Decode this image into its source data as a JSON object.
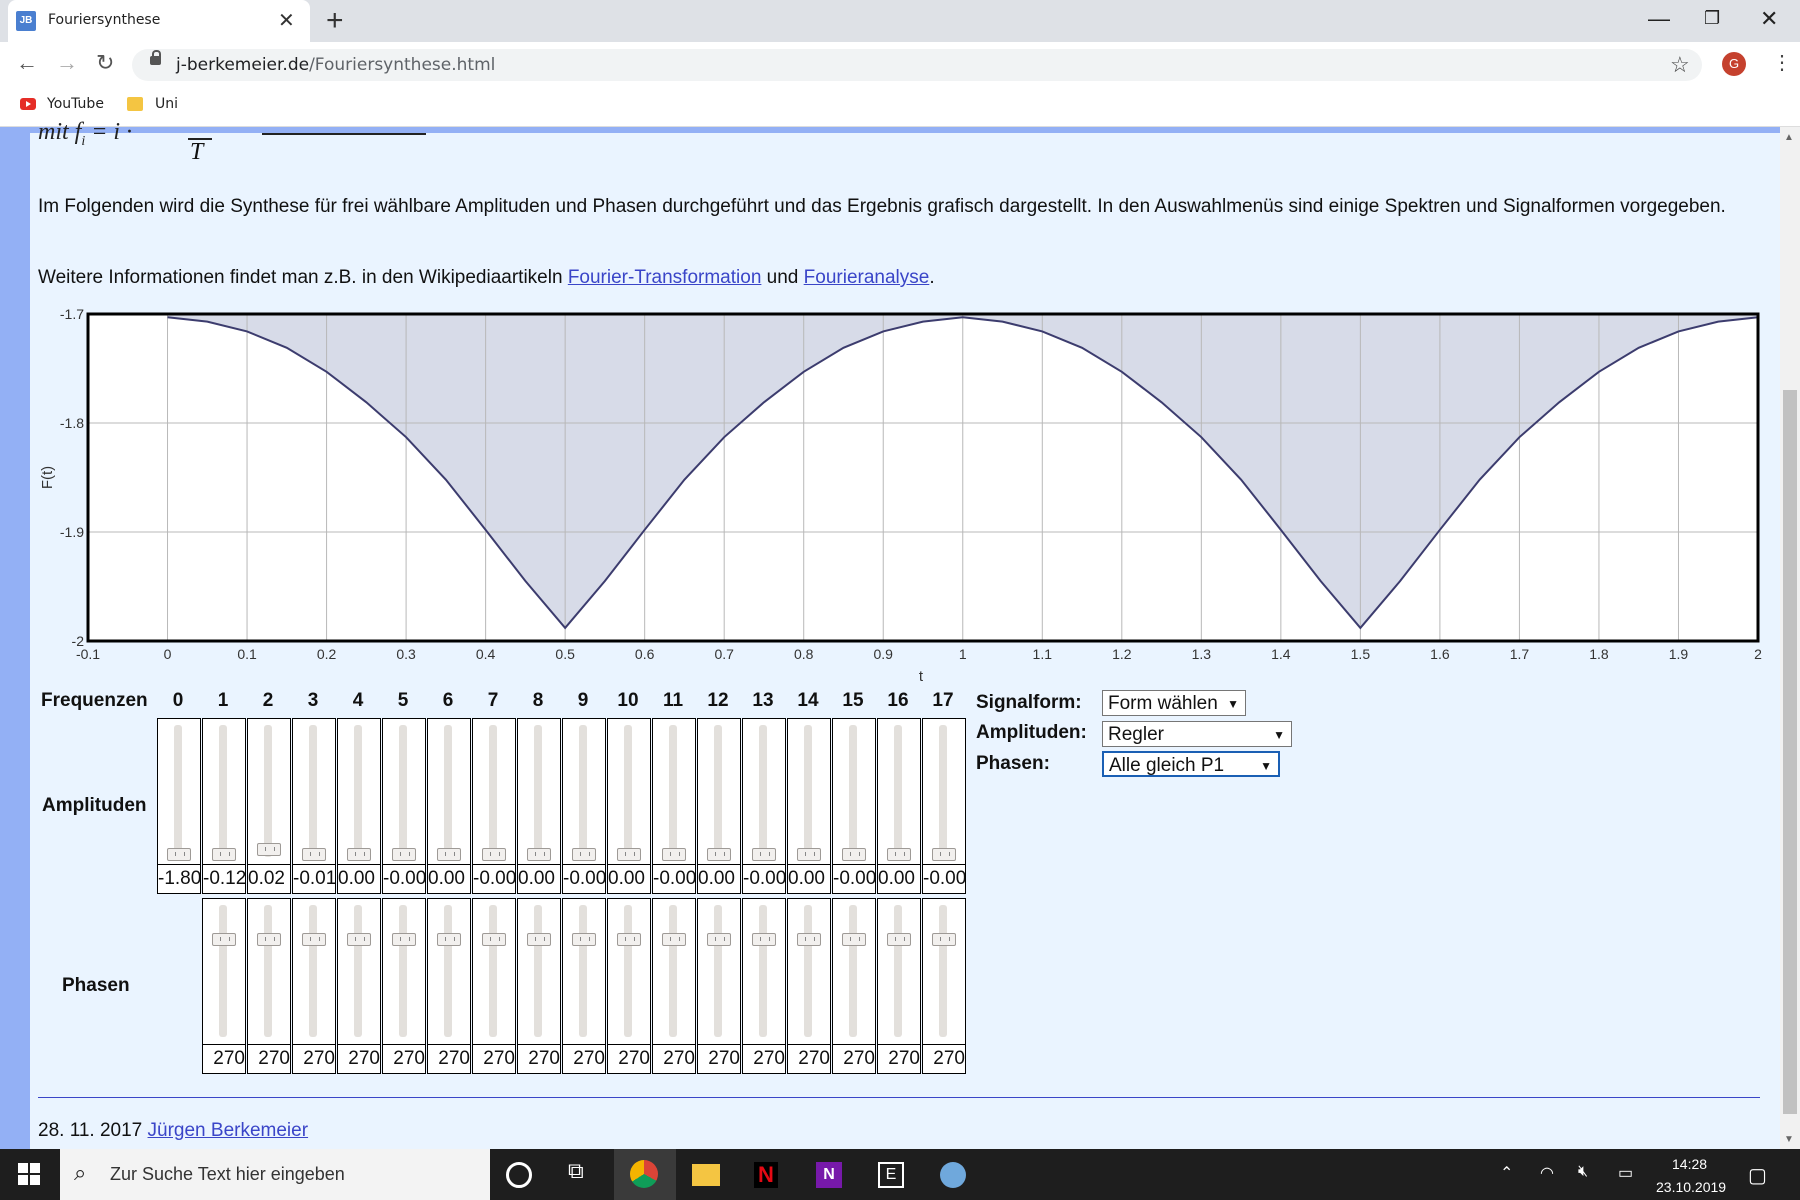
{
  "browser": {
    "tab_title": "Fouriersynthese",
    "tab_favicon": "JB",
    "new_tab": "+",
    "url_domain": "j-berkemeier.de",
    "url_path": "/Fouriersynthese.html",
    "profile_initial": "G",
    "bookmarks": [
      "YouTube",
      "Uni"
    ]
  },
  "content": {
    "formula_fragment": "mit f",
    "formula_sub": "i",
    "formula_rest": " = i · ",
    "formula_T": "T",
    "para1": "Im Folgenden wird die Synthese für frei wählbare Amplituden und Phasen durchgeführt und das Ergebnis grafisch dargestellt. In den Auswahlmenüs sind einige Spektren und Signalformen vorgegeben.",
    "para2_prefix": "Weitere Informationen findet man z.B. in den Wikipediaartikeln ",
    "link1": "Fourier-Transformation",
    "para2_mid": " und ",
    "link2": "Fourieranalyse",
    "para2_suffix": "."
  },
  "chart_data": {
    "type": "area",
    "xlabel": "t",
    "ylabel": "F(t)",
    "xlim": [
      -0.1,
      2.0
    ],
    "ylim": [
      -2.0,
      -1.7
    ],
    "x_ticks": [
      "-0.1",
      "0",
      "0.1",
      "0.2",
      "0.3",
      "0.4",
      "0.5",
      "0.6",
      "0.7",
      "0.8",
      "0.9",
      "1",
      "1.1",
      "1.2",
      "1.3",
      "1.4",
      "1.5",
      "1.6",
      "1.7",
      "1.8",
      "1.9",
      "2"
    ],
    "y_ticks": [
      "-1.7",
      "-1.8",
      "-1.9",
      "-2"
    ],
    "grid": true,
    "series": [
      {
        "x": [
          0,
          0.05,
          0.1,
          0.15,
          0.2,
          0.25,
          0.3,
          0.35,
          0.4,
          0.45,
          0.5,
          0.55,
          0.6,
          0.65,
          0.7,
          0.75,
          0.8,
          0.85,
          0.9,
          0.95,
          1.0,
          1.05,
          1.1,
          1.15,
          1.2,
          1.25,
          1.3,
          1.35,
          1.4,
          1.45,
          1.5,
          1.55,
          1.6,
          1.65,
          1.7,
          1.75,
          1.8,
          1.85,
          1.9,
          1.95,
          2.0
        ],
        "values": [
          -1.703,
          -1.707,
          -1.716,
          -1.731,
          -1.753,
          -1.781,
          -1.813,
          -1.852,
          -1.898,
          -1.945,
          -1.988,
          -1.945,
          -1.898,
          -1.852,
          -1.813,
          -1.781,
          -1.753,
          -1.731,
          -1.716,
          -1.707,
          -1.703,
          -1.707,
          -1.716,
          -1.731,
          -1.753,
          -1.781,
          -1.813,
          -1.852,
          -1.898,
          -1.945,
          -1.988,
          -1.945,
          -1.898,
          -1.852,
          -1.813,
          -1.781,
          -1.753,
          -1.731,
          -1.716,
          -1.707,
          -1.703
        ]
      }
    ],
    "fill_color": "#d7dbe8",
    "line_color": "#3c3c6e"
  },
  "controls": {
    "frequencies_label": "Frequenzen",
    "amplitudes_label": "Amplituden",
    "phases_label": "Phasen",
    "frequencies": [
      "0",
      "1",
      "2",
      "3",
      "4",
      "5",
      "6",
      "7",
      "8",
      "9",
      "10",
      "11",
      "12",
      "13",
      "14",
      "15",
      "16",
      "17"
    ],
    "amplitude_values": [
      "-1.80",
      "-0.12",
      "0.02",
      "-0.01",
      "0.00",
      "-0.00",
      "0.00",
      "-0.00",
      "0.00",
      "-0.00",
      "0.00",
      "-0.00",
      "0.00",
      "-0.00",
      "0.00",
      "-0.00",
      "0.00",
      "-0.00"
    ],
    "phase_values": [
      "270",
      "270",
      "270",
      "270",
      "270",
      "270",
      "270",
      "270",
      "270",
      "270",
      "270",
      "270",
      "270",
      "270",
      "270",
      "270",
      "270"
    ],
    "signalform_label": "Signalform:",
    "signalform_value": "Form wählen",
    "amplituden_sel_label": "Amplituden:",
    "amplituden_sel_value": "Regler",
    "phasen_sel_label": "Phasen:",
    "phasen_sel_value": "Alle gleich P1"
  },
  "footer": {
    "date": "28. 11. 2017 ",
    "author": "Jürgen Berkemeier"
  },
  "taskbar": {
    "search_placeholder": "Zur Suche Text hier eingeben",
    "time": "14:28",
    "date": "23.10.2019"
  }
}
